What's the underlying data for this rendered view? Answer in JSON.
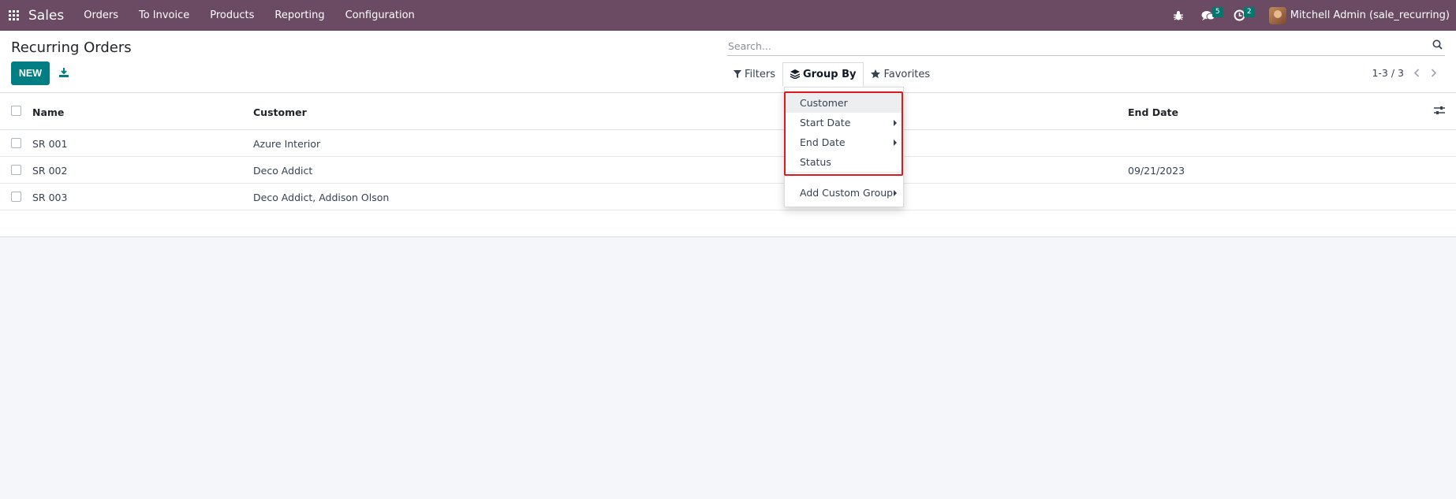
{
  "navbar": {
    "apps_icon": "apps-grid-icon",
    "brand": "Sales",
    "menu": [
      "Orders",
      "To Invoice",
      "Products",
      "Reporting",
      "Configuration"
    ],
    "messages_badge": "5",
    "activities_badge": "2",
    "user_name": "Mitchell Admin (sale_recurring)",
    "color": "#6b4a63"
  },
  "control": {
    "title": "Recurring Orders",
    "new_label": "NEW",
    "search_placeholder": "Search...",
    "filters_label": "Filters",
    "groupby_label": "Group By",
    "favorites_label": "Favorites",
    "pager": "1-3 / 3",
    "accent": "#017e84"
  },
  "table": {
    "columns": [
      "Name",
      "Customer",
      "End Date"
    ],
    "rows": [
      {
        "name": "SR 001",
        "customer": "Azure Interior",
        "end_date": ""
      },
      {
        "name": "SR 002",
        "customer": "Deco Addict",
        "end_date": "09/21/2023"
      },
      {
        "name": "SR 003",
        "customer": "Deco Addict, Addison Olson",
        "end_date": ""
      }
    ]
  },
  "groupby_menu": {
    "items": [
      "Customer",
      "Start Date",
      "End Date",
      "Status"
    ],
    "custom_group": "Add Custom Group",
    "highlight_color": "#e0191f"
  }
}
